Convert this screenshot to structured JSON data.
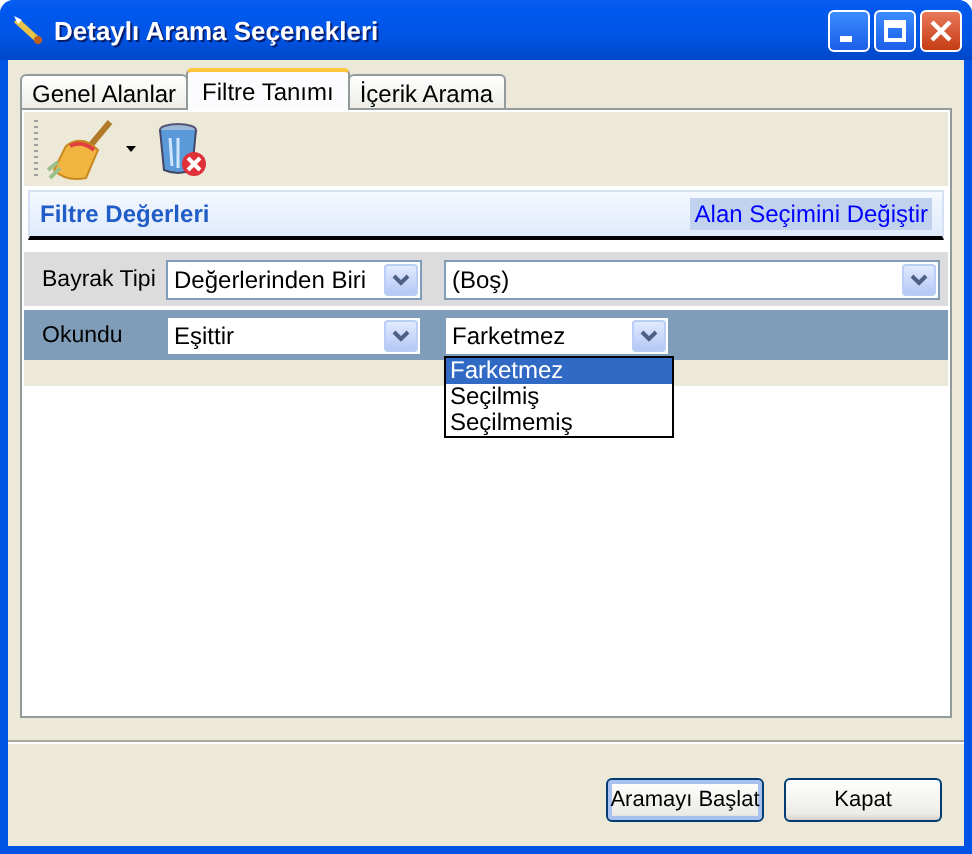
{
  "window": {
    "title": "Detaylı Arama Seçenekleri"
  },
  "tabs": [
    {
      "label": "Genel Alanlar",
      "selected": false
    },
    {
      "label": "Filtre Tanımı",
      "selected": true
    },
    {
      "label": "İçerik Arama",
      "selected": false
    }
  ],
  "panel": {
    "title": "Filtre Değerleri",
    "link": "Alan Seçimini Değiştir"
  },
  "filters": [
    {
      "label": "Bayrak Tipi",
      "operator": "Değerlerinden Biri",
      "value": "(Boş)",
      "selected": false,
      "expanded": false
    },
    {
      "label": "Okundu",
      "operator": "Eşittir",
      "value": "Farketmez",
      "selected": true,
      "expanded": true,
      "options": [
        {
          "label": "Farketmez",
          "selected": true
        },
        {
          "label": "Seçilmiş",
          "selected": false
        },
        {
          "label": "Seçilmemiş",
          "selected": false
        }
      ]
    }
  ],
  "buttons": [
    {
      "label": "Aramayı Başlat",
      "default": true
    },
    {
      "label": "Kapat",
      "default": false
    }
  ]
}
